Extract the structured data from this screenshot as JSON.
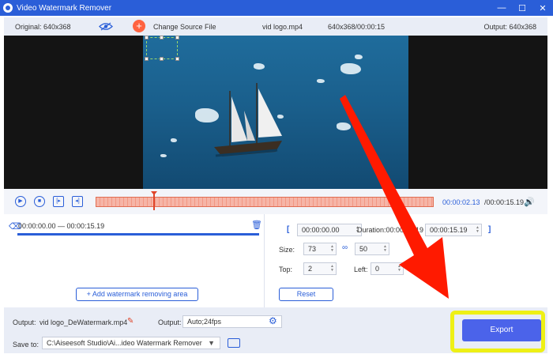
{
  "window": {
    "title": "Video Watermark Remover",
    "controls": [
      "—",
      "☐",
      "✕"
    ]
  },
  "toolbar": {
    "original": "Original: 640x368",
    "change_source": "Change Source File",
    "file_name": "vid logo.mp4",
    "file_meta": "640x368/00:00:15",
    "output_res": "Output: 640x368"
  },
  "player": {
    "current_time": "00:00:02.13",
    "total_time": "/00:00:15.19",
    "progress": 0.17
  },
  "segment": {
    "range": "00:00:00.00 — 00:00:15.19"
  },
  "left_panel": {
    "add_area_label": "Add watermark removing area"
  },
  "right_panel": {
    "start_time": "00:00:00.00",
    "duration_label": "Duration:00:00:15.19",
    "end_time": "00:00:15.19",
    "size_label": "Size:",
    "width": "73",
    "height": "50",
    "top_label": "Top:",
    "top": "2",
    "left_label": "Left:",
    "left": "0",
    "reset_label": "Reset"
  },
  "footer": {
    "output_label": "Output:",
    "output_file": "vid logo_DeWatermark.mp4",
    "output_format_label": "Output:",
    "output_format": "Auto;24fps",
    "save_to_label": "Save to:",
    "save_path": "C:\\Aiseesoft Studio\\Ai...ideo Watermark Remover",
    "export_label": "Export"
  },
  "colors": {
    "accent": "#2a5ed8",
    "highlight": "#eef016",
    "arrow": "#ff1a00",
    "export": "#4b63ea"
  }
}
